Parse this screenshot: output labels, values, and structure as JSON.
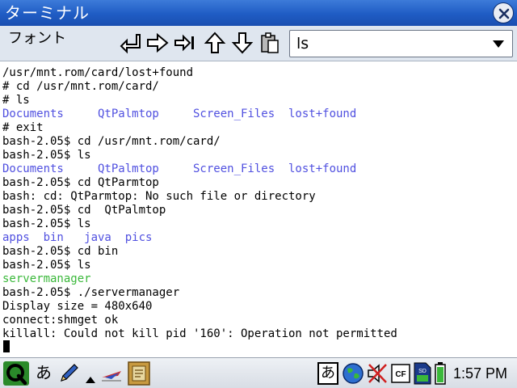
{
  "window": {
    "title": "ターミナル"
  },
  "toolbar": {
    "font_menu": "フォント",
    "command_value": "ls"
  },
  "terminal": {
    "lines": [
      {
        "text": "/usr/mnt.rom/card/lost+found",
        "style": "normal"
      },
      {
        "text": "# cd /usr/mnt.rom/card/",
        "style": "normal"
      },
      {
        "text": "# ls",
        "style": "normal"
      },
      {
        "text": "Documents     QtPalmtop     Screen_Files  lost+found",
        "style": "blue"
      },
      {
        "text": "# exit",
        "style": "normal"
      },
      {
        "text": "bash-2.05$ cd /usr/mnt.rom/card/",
        "style": "normal"
      },
      {
        "text": "bash-2.05$ ls",
        "style": "normal"
      },
      {
        "text": "Documents     QtPalmtop     Screen_Files  lost+found",
        "style": "blue"
      },
      {
        "text": "bash-2.05$ cd QtParmtop",
        "style": "normal"
      },
      {
        "text": "bash: cd: QtParmtop: No such file or directory",
        "style": "normal"
      },
      {
        "text": "bash-2.05$ cd  QtPalmtop",
        "style": "normal"
      },
      {
        "text": "bash-2.05$ ls",
        "style": "normal"
      },
      {
        "text": "apps  bin   java  pics",
        "style": "blue"
      },
      {
        "text": "bash-2.05$ cd bin",
        "style": "normal"
      },
      {
        "text": "bash-2.05$ ls",
        "style": "normal"
      },
      {
        "text": "servermanager",
        "style": "green"
      },
      {
        "text": "bash-2.05$ ./servermanager",
        "style": "normal"
      },
      {
        "text": "Display size = 480x640",
        "style": "normal"
      },
      {
        "text": "connect:shmget ok",
        "style": "normal"
      },
      {
        "text": "killall: Could not kill pid '160': Operation not permitted",
        "style": "normal"
      }
    ]
  },
  "taskbar": {
    "input_mode": "あ",
    "ime_indicator": "あ",
    "clock": "1:57 PM"
  },
  "colors": {
    "titlebar": "#1f5cc4",
    "dir_listing": "#5050e0",
    "executable": "#3ab83a"
  }
}
